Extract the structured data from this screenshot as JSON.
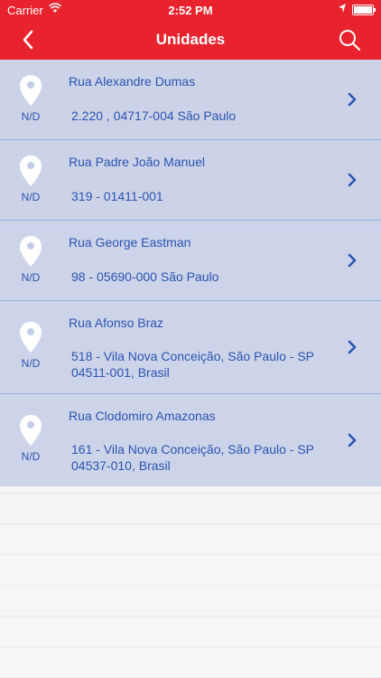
{
  "status_bar": {
    "carrier": "Carrier",
    "time": "2:52 PM"
  },
  "nav": {
    "title": "Unidades"
  },
  "units": [
    {
      "nd": "N/D",
      "street": "Rua Alexandre Dumas",
      "address": "2.220 , 04717-004 São Paulo"
    },
    {
      "nd": "N/D",
      "street": "Rua Padre João Manuel",
      "address": "319 - 01411-001"
    },
    {
      "nd": "N/D",
      "street": "Rua George Eastman",
      "address": "98 - 05690-000 São Paulo"
    },
    {
      "nd": "N/D",
      "street": "Rua Afonso Braz",
      "address": "518 - Vila Nova Conceição, São Paulo - SP 04511-001, Brasil"
    },
    {
      "nd": "N/D",
      "street": "Rua Clodomiro Amazonas",
      "address": "161 - Vila Nova Conceição, São Paulo - SP 04537-010, Brasil"
    }
  ],
  "colors": {
    "brand": "#e8232d",
    "text": "#2a55b0",
    "list_bg": "#c4cde8"
  }
}
